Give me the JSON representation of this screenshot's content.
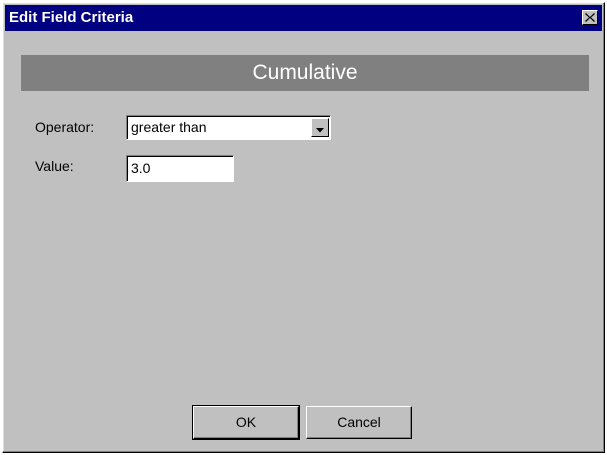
{
  "window": {
    "title": "Edit Field Criteria",
    "close_icon": "close-icon"
  },
  "banner": {
    "title": "Cumulative"
  },
  "form": {
    "operator_label": "Operator:",
    "operator_value": "greater than",
    "value_label": "Value:",
    "value_value": "3.0"
  },
  "buttons": {
    "ok_label": "OK",
    "cancel_label": "Cancel"
  },
  "colors": {
    "titlebar": "#000080",
    "banner": "#808080",
    "dialog_bg": "#c0c0c0"
  }
}
